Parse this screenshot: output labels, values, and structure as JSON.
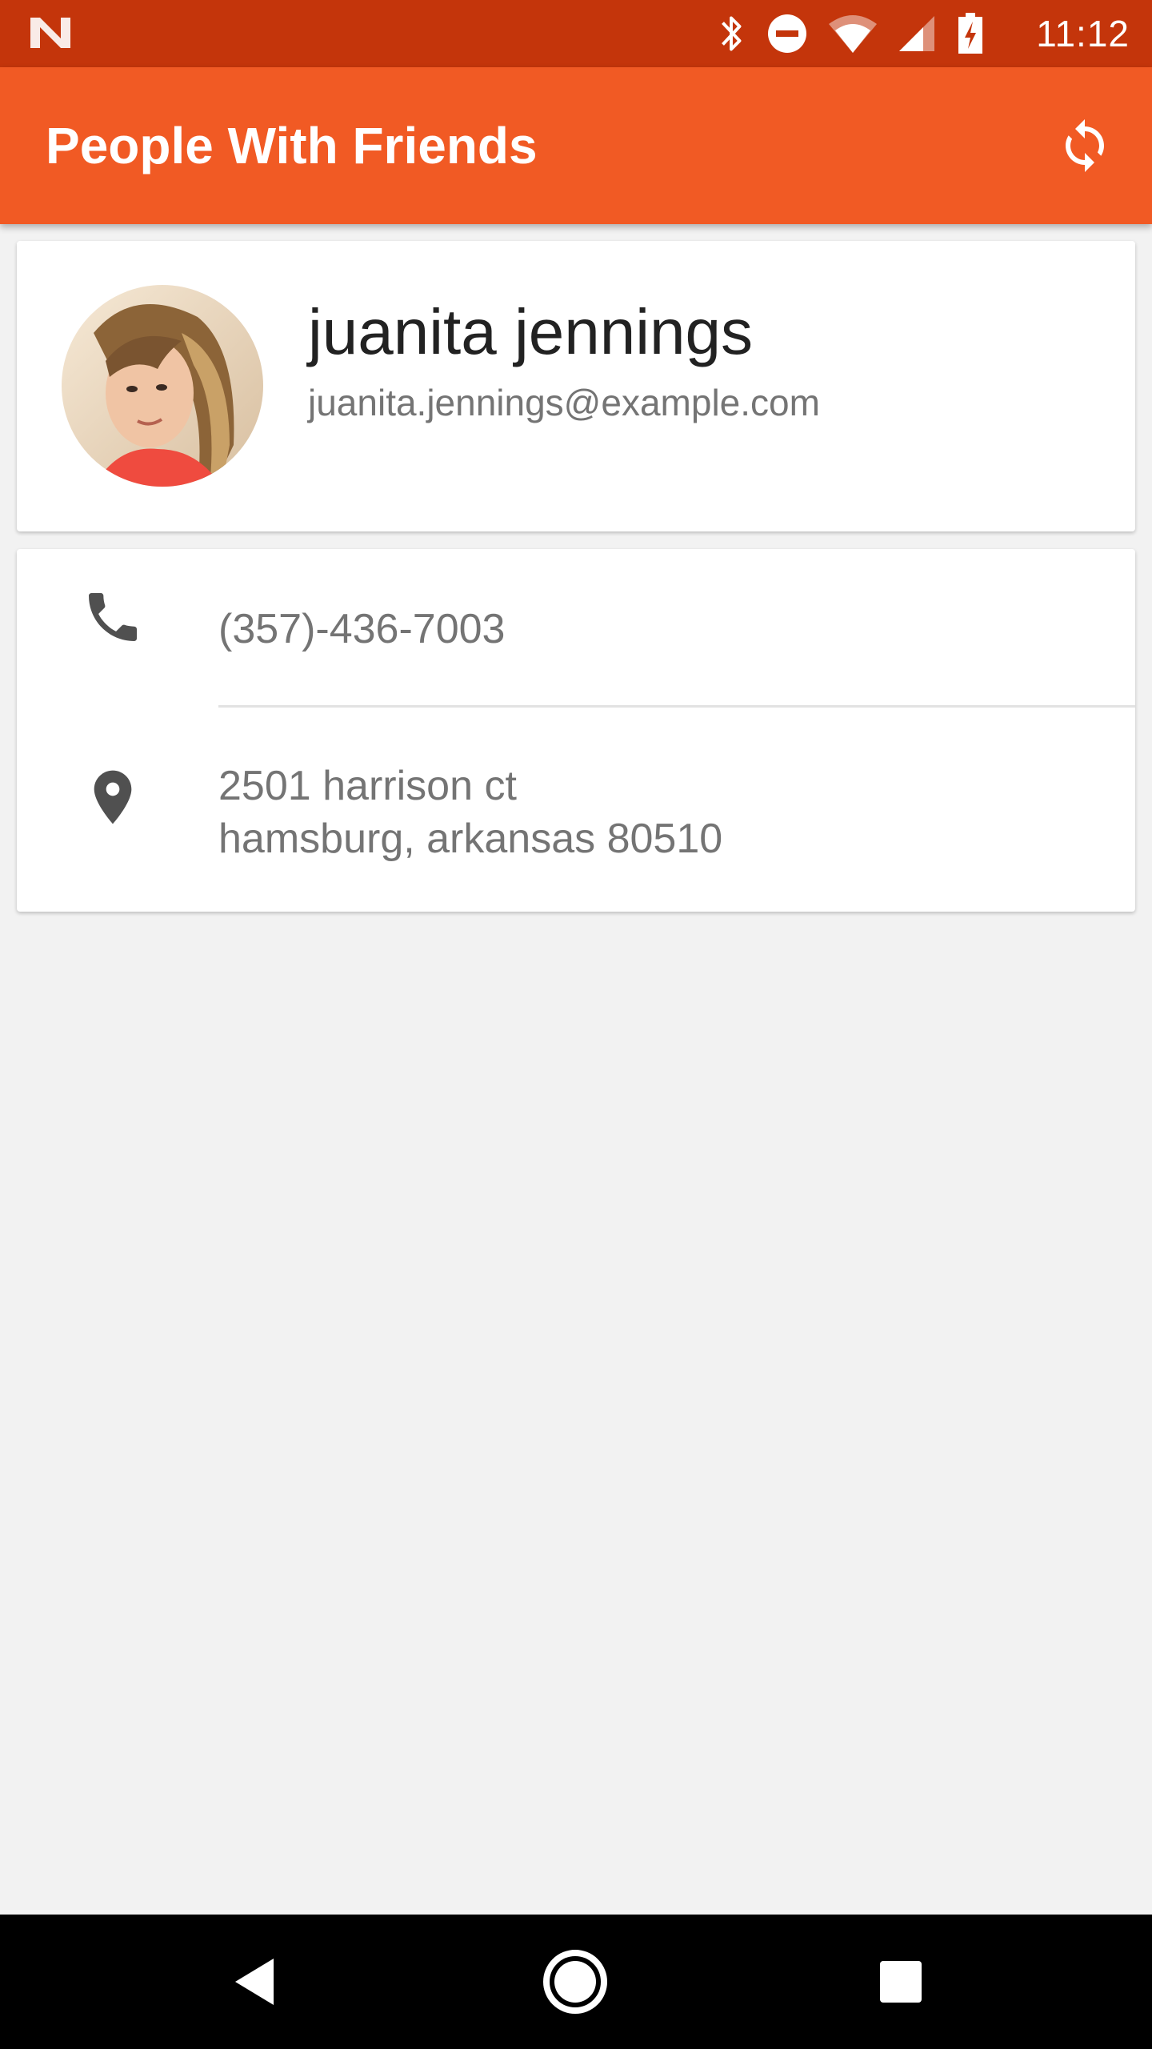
{
  "status_bar": {
    "time": "11:12",
    "icons": [
      "notification-n-icon",
      "bluetooth-icon",
      "do-not-disturb-icon",
      "wifi-icon",
      "cell-signal-icon",
      "battery-charging-icon"
    ]
  },
  "app_bar": {
    "title": "People With Friends",
    "action_icon": "refresh-icon"
  },
  "profile": {
    "name": "juanita jennings",
    "email": "juanita.jennings@example.com"
  },
  "contact": {
    "phone": "(357)-436-7003",
    "address_line1": "2501 harrison ct",
    "address_line2": "hamsburg, arkansas 80510",
    "phone_icon": "phone-icon",
    "address_icon": "location-pin-icon"
  },
  "nav_bar": {
    "buttons": [
      "back-icon",
      "home-icon",
      "recents-icon"
    ]
  },
  "colors": {
    "status_bar": "#c4350b",
    "app_bar": "#f15a24",
    "background": "#f2f2f2",
    "card": "#ffffff",
    "secondary_text": "#747474",
    "primary_text": "#222222"
  }
}
